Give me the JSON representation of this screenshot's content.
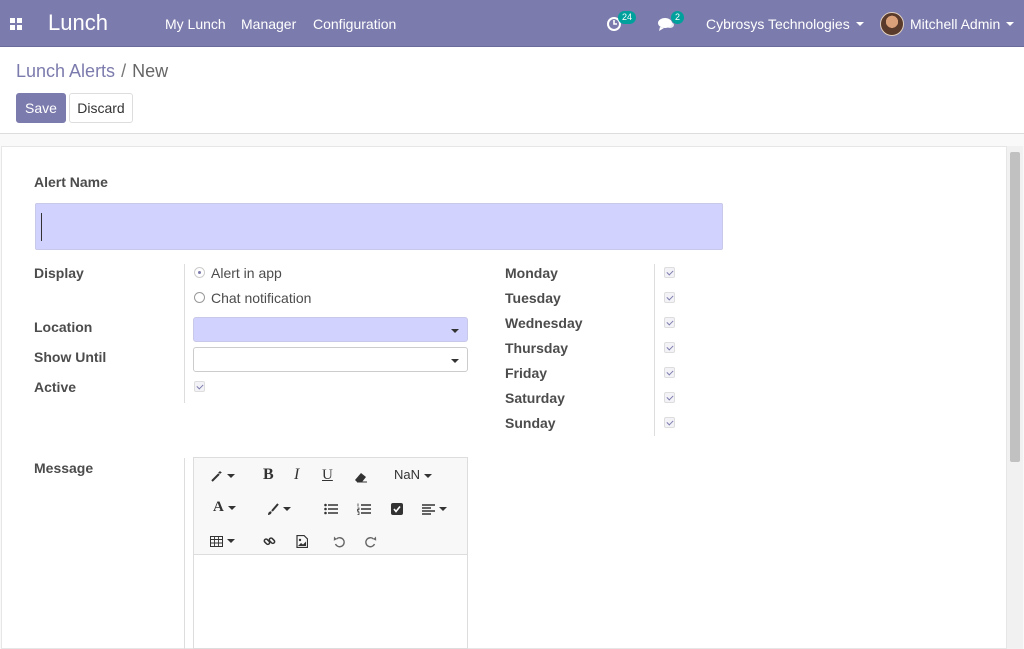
{
  "navbar": {
    "brand": "Lunch",
    "menus": [
      "My Lunch",
      "Manager",
      "Configuration"
    ],
    "activity_count": "24",
    "message_count": "2",
    "company": "Cybrosys Technologies",
    "user": "Mitchell Admin"
  },
  "breadcrumb": {
    "parent": "Lunch Alerts",
    "separator": "/",
    "current": "New"
  },
  "buttons": {
    "save": "Save",
    "discard": "Discard"
  },
  "form": {
    "alert_name_label": "Alert Name",
    "alert_name_value": "",
    "display_label": "Display",
    "display_options": [
      {
        "label": "Alert in app",
        "selected": true
      },
      {
        "label": "Chat notification",
        "selected": false
      }
    ],
    "location_label": "Location",
    "location_value": "",
    "show_until_label": "Show Until",
    "show_until_value": "",
    "active_label": "Active",
    "active_checked": true,
    "days": [
      {
        "label": "Monday",
        "checked": true
      },
      {
        "label": "Tuesday",
        "checked": true
      },
      {
        "label": "Wednesday",
        "checked": true
      },
      {
        "label": "Thursday",
        "checked": true
      },
      {
        "label": "Friday",
        "checked": true
      },
      {
        "label": "Saturday",
        "checked": true
      },
      {
        "label": "Sunday",
        "checked": true
      }
    ],
    "message_label": "Message"
  },
  "editor_toolbar": {
    "font_size_label": "NaN",
    "bold": "B",
    "italic": "I",
    "underline": "U",
    "font_color": "A"
  },
  "colors": {
    "brand": "#7c7bad",
    "required_field": "#d2d2ff",
    "badge": "#00a09d"
  }
}
